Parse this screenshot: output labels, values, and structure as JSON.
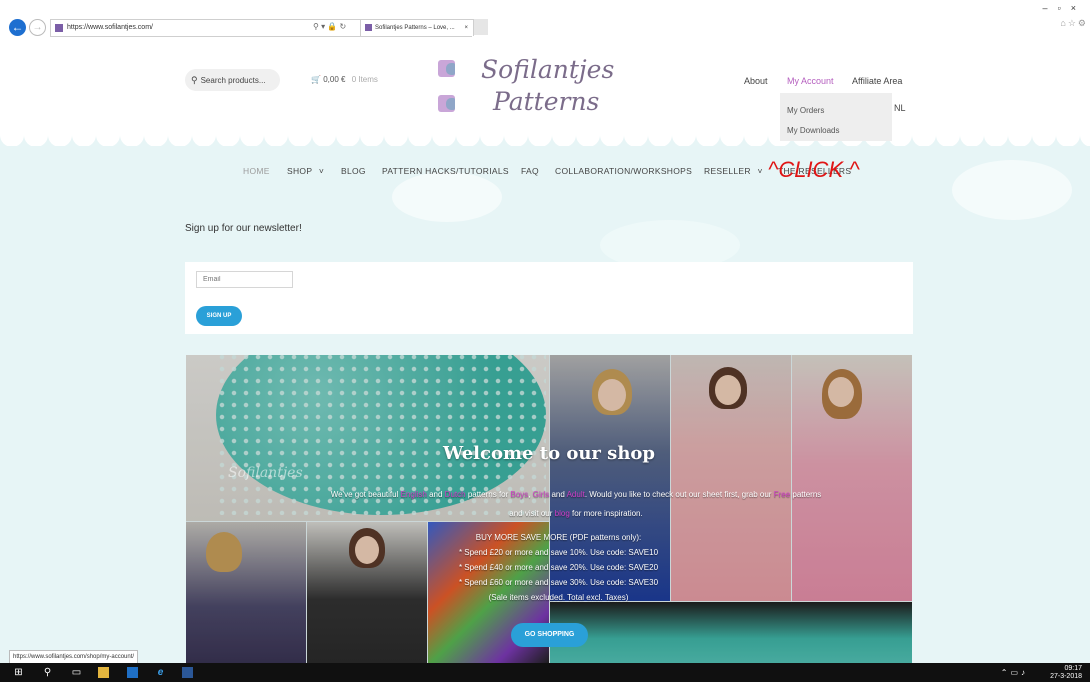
{
  "browser": {
    "url": "https://www.sofilantjes.com/",
    "tab_title": "Sofilantjes Patterns – Love, ...",
    "back_icon": "arrow-left-icon",
    "status_url": "https://www.sofilantjes.com/shop/my-account/"
  },
  "header": {
    "search_placeholder": "Search products...",
    "cart_amount": "0,00 €",
    "cart_items": "0 Items",
    "logo_line1": "Sofilantjes",
    "logo_line2": "Patterns",
    "top_links": [
      "About",
      "My Account",
      "Affiliate Area"
    ],
    "language": "NL"
  },
  "account_dropdown": {
    "items": [
      "My Orders",
      "My Downloads"
    ]
  },
  "main_menu": {
    "items": [
      "HOME",
      "SHOP",
      "BLOG",
      "PATTERN HACKS/TUTORIALS",
      "FAQ",
      "COLLABORATION/WORKSHOPS",
      "RESELLER",
      "THE RESELLERS"
    ],
    "dropdown_caret": "˅"
  },
  "annotation": {
    "text": "^CLICK ^"
  },
  "newsletter": {
    "title": "Sign up for our newsletter!",
    "email_placeholder": "Email",
    "button": "SIGN UP"
  },
  "hero": {
    "title": "Welcome to our shop",
    "intro_prefix": "We've got beautiful",
    "word_english": "English",
    "word_and": "and",
    "word_dutch": "Dutch",
    "patterns_for": "patterns for",
    "word_boys": "Boys",
    "word_girls": "Girls",
    "and2": "and",
    "word_adult": "Adult",
    "check_out": ". Would you like to check out our sheet first, grab our",
    "word_free": "Free",
    "patterns_end": "patterns",
    "visit_prefix": "and visit our",
    "word_blog": "blog",
    "visit_suffix": "for more inspiration.",
    "promo_lines": [
      "BUY MORE SAVE MORE (PDF patterns only):",
      "* Spend £20 or more and save 10%. Use code: SAVE10",
      "* Spend £40 or more and save 20%. Use code: SAVE20",
      "* Spend £60 or more and save 30%. Use code: SAVE30",
      "(Sale items excluded. Total excl. Taxes)"
    ],
    "button": "GO SHOPPING"
  },
  "taskbar": {
    "time": "09:17",
    "date": "27-3-2018"
  },
  "colors": {
    "accent_blue": "#2aa0d8",
    "accent_purple": "#b55fbf",
    "annotation_red": "#e01515",
    "page_bg": "#e7f5f6"
  }
}
